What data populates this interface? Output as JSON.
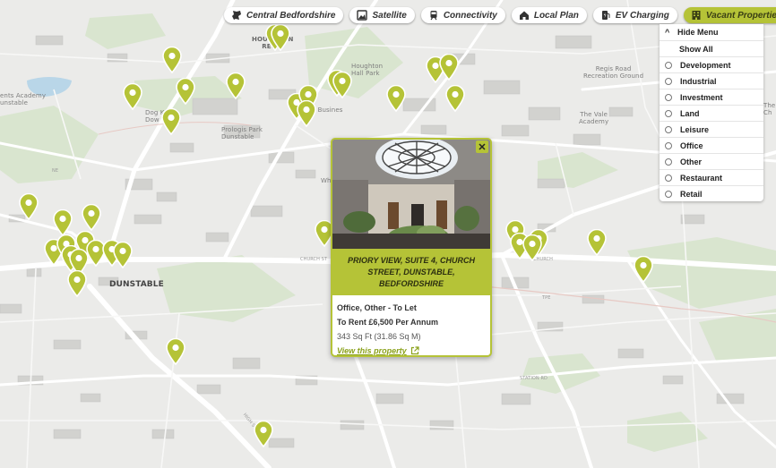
{
  "map": {
    "labels": {
      "town": "DUNSTABLE",
      "houghton_regis": "HOUGHTON\nREGIS",
      "houghton_hall_park": "Houghton\nHall Park",
      "regis_road": "Regis Road\nRecreation Ground",
      "vale_academy": "The Vale\nAcademy",
      "prologis": "Prologis Park\nDunstable",
      "academy": "ents Academy\nunstable",
      "dog_kennel": "Dog Ken\nDow",
      "business": "x Busines",
      "church_st": "CHURCH ST",
      "high_st": "HIGH ST",
      "church_st2": "CHURCH",
      "station_rd": "STATION RD",
      "ne": "NE",
      "tpe": "TPE",
      "wh": "Wh",
      "the": "The\nCh"
    }
  },
  "toolbar": {
    "items": [
      {
        "label": "Central Bedfordshire",
        "icon": "county-icon",
        "active": false
      },
      {
        "label": "Satellite",
        "icon": "satellite-icon",
        "active": false
      },
      {
        "label": "Connectivity",
        "icon": "train-icon",
        "active": false
      },
      {
        "label": "Local Plan",
        "icon": "house-icon",
        "active": false
      },
      {
        "label": "EV Charging",
        "icon": "ev-charging-icon",
        "active": false
      },
      {
        "label": "Vacant Properties",
        "icon": "building-icon",
        "active": true
      }
    ]
  },
  "menu": {
    "hide_label": "Hide Menu",
    "show_all_label": "Show All",
    "options": [
      "Development",
      "Industrial",
      "Investment",
      "Land",
      "Leisure",
      "Office",
      "Other",
      "Restaurant",
      "Retail"
    ]
  },
  "popup": {
    "title": "PRIORY VIEW, SUITE 4, CHURCH STREET, DUNSTABLE, BEDFORDSHIRE",
    "type": "Office, Other - To Let",
    "price": "To Rent £6,500 Per Annum",
    "size": "343 Sq Ft (31.86 Sq M)",
    "link_label": "View this property",
    "close_label": "✕"
  },
  "pins": {
    "count": 37,
    "color": "#b5c337"
  },
  "colors": {
    "accent": "#b5c337",
    "map_bg": "#ebebe9",
    "road": "#ffffff",
    "park": "#d8e6cf",
    "water": "#b7d7ea",
    "building": "#d3d3d1"
  }
}
